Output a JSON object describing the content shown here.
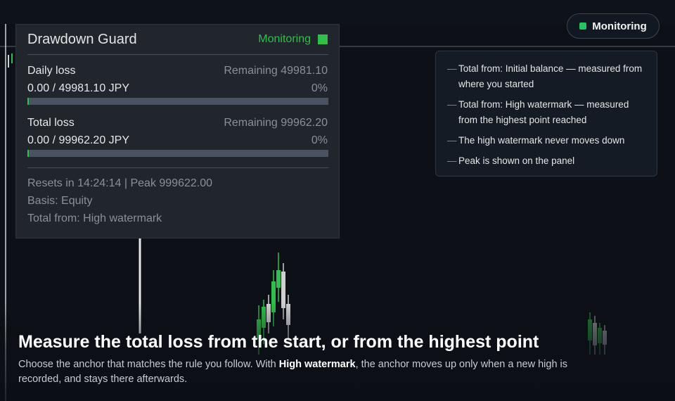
{
  "header": {
    "status_label": "Monitoring",
    "status_color": "#23c55e"
  },
  "panel": {
    "title": "Drawdown Guard",
    "status_label": "Monitoring",
    "daily": {
      "label": "Daily loss",
      "remaining": "Remaining 49981.10",
      "value": "0.00 / 49981.10 JPY",
      "percent": "0%",
      "progress_fraction": 0.0
    },
    "total": {
      "label": "Total loss",
      "remaining": "Remaining 99962.20",
      "value": "0.00 / 99962.20 JPY",
      "percent": "0%",
      "progress_fraction": 0.0
    },
    "resets_line": "Resets in 14:24:14  |  Peak 999622.00",
    "basis": "Basis: Equity",
    "total_from": "Total from: High watermark"
  },
  "info": {
    "items": [
      "Total from: Initial balance — measured from where you started",
      "Total from: High watermark — measured from the highest point reached",
      "The high watermark never moves down",
      "Peak is shown on the panel"
    ]
  },
  "caption": {
    "headline": "Measure the total loss from the start, or from the highest point",
    "body_before": "Choose the anchor that matches the rule you follow. With ",
    "body_bold": "High watermark",
    "body_after": ", the anchor moves up only when a new high is recorded, and stays there afterwards."
  },
  "colors": {
    "accent_green": "#2fbf4a",
    "panel_bg": "#22272e",
    "background": "#0b0f15"
  }
}
